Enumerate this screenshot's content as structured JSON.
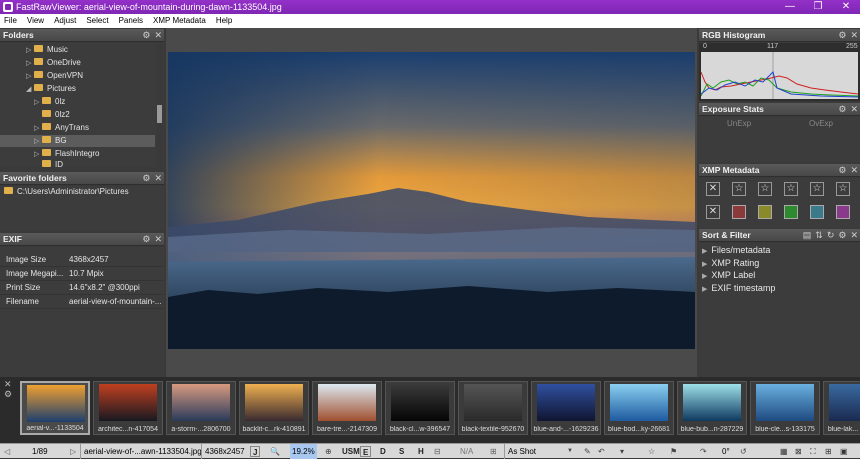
{
  "titlebar": {
    "title": "FastRawViewer: aerial-view-of-mountain-during-dawn-1133504.jpg",
    "min": "—",
    "max": "❐",
    "close": "✕"
  },
  "menu": [
    "File",
    "View",
    "Adjust",
    "Select",
    "Panels",
    "XMP Metadata",
    "Help"
  ],
  "folders": {
    "title": "Folders",
    "items": [
      {
        "label": "Music",
        "arrow": "▷"
      },
      {
        "label": "OneDrive",
        "arrow": "▷"
      },
      {
        "label": "OpenVPN",
        "arrow": "▷"
      },
      {
        "label": "Pictures",
        "arrow": "◢"
      },
      {
        "label": "0lz",
        "arrow": "▷"
      },
      {
        "label": "0lz2",
        "arrow": ""
      },
      {
        "label": "AnyTrans",
        "arrow": "▷"
      },
      {
        "label": "BG",
        "arrow": "▷"
      },
      {
        "label": "FlashIntegro",
        "arrow": "▷"
      },
      {
        "label": "ID",
        "arrow": ""
      }
    ]
  },
  "favorites": {
    "title": "Favorite folders",
    "items": [
      "C:\\Users\\Administrator\\Pictures"
    ]
  },
  "exif": {
    "title": "EXIF",
    "rows": [
      {
        "k": "Image Size",
        "v": "4368x2457"
      },
      {
        "k": "Image Megapi...",
        "v": "10.7 Mpix"
      },
      {
        "k": "Print Size",
        "v": "14.6\"x8.2\" @300ppi"
      },
      {
        "k": "Filename",
        "v": "aerial-view-of-mountain-..."
      }
    ]
  },
  "histogram": {
    "title": "RGB Histogram",
    "ticks": [
      "0",
      "117",
      "255"
    ]
  },
  "exposure": {
    "title": "Exposure Stats",
    "unexp": "UnExp",
    "ovexp": "OvExp"
  },
  "xmp": {
    "title": "XMP Metadata",
    "reject": "✕",
    "star": "☆",
    "colors": [
      "#8a3a3a",
      "#8a8a2a",
      "#2e8a2e",
      "#3a7a8a",
      "#8a3a8a"
    ]
  },
  "sortfilter": {
    "title": "Sort & Filter",
    "items": [
      "Files/metadata",
      "XMP Rating",
      "XMP Label",
      "EXIF timestamp"
    ]
  },
  "thumbs": [
    {
      "label": "aerial-v...-1133504",
      "c1": "#f0a030",
      "c2": "#1d3f6e"
    },
    {
      "label": "architec...n-417054",
      "c1": "#c04020",
      "c2": "#181820"
    },
    {
      "label": "a-storm-...2806700",
      "c1": "#d89a80",
      "c2": "#2a3a5a"
    },
    {
      "label": "backlit-c...rk-410891",
      "c1": "#f0b050",
      "c2": "#3a2a30"
    },
    {
      "label": "bare-tre...-2147309",
      "c1": "#dde8f0",
      "c2": "#a05030"
    },
    {
      "label": "black-cl...w-396547",
      "c1": "#3a3a3a",
      "c2": "#050505"
    },
    {
      "label": "black-textile-952670",
      "c1": "#555555",
      "c2": "#2a2a2a"
    },
    {
      "label": "blue-and-...-1629236",
      "c1": "#3050a0",
      "c2": "#101530"
    },
    {
      "label": "blue-bod...ky-26681",
      "c1": "#8ad0f0",
      "c2": "#1e5aa0"
    },
    {
      "label": "blue-bub...n-287229",
      "c1": "#9ee0e8",
      "c2": "#0e3a60"
    },
    {
      "label": "blue-cle...s-133175",
      "c1": "#6ab0e0",
      "c2": "#1e4a80"
    },
    {
      "label": "blue-lak...",
      "c1": "#3a6aa0",
      "c2": "#1a2a50"
    }
  ],
  "status": {
    "counter": "1/89",
    "filename": "aerial-view-of-...awn-1133504.jpg",
    "size": "4368x2457",
    "j": "J",
    "zoom": "19.2%",
    "usm": "USM",
    "e": "E",
    "d": "D",
    "s": "S",
    "h": "H",
    "na": "N/A",
    "asshot": "As Shot",
    "rotation": "0°"
  }
}
